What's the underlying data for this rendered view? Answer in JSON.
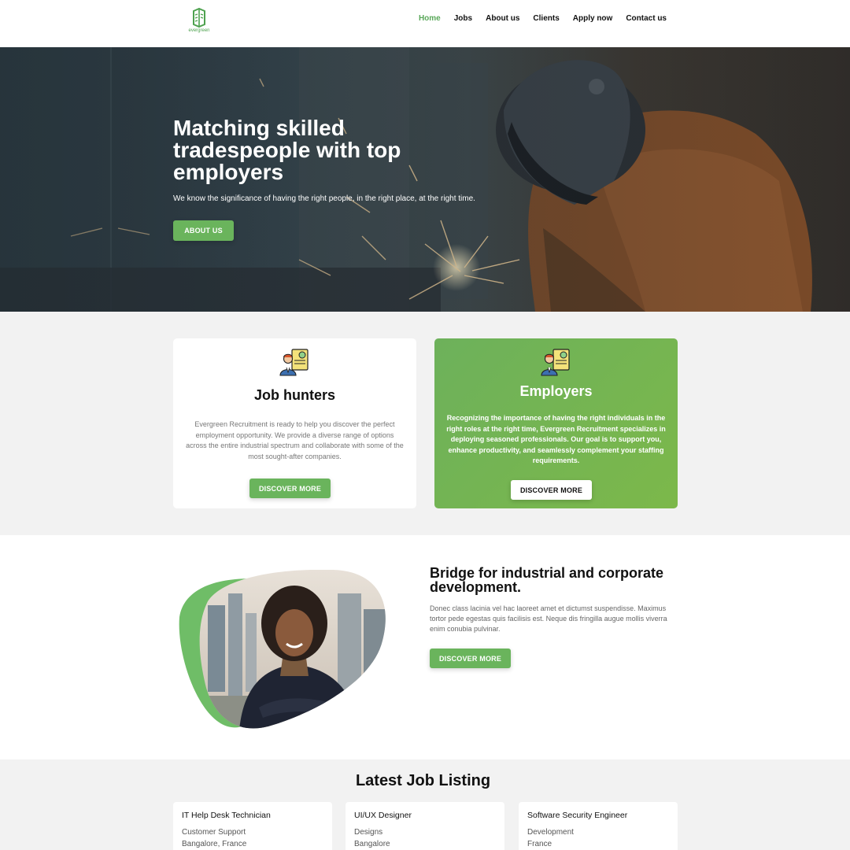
{
  "header": {
    "logo_text": "evergreen",
    "nav": [
      {
        "label": "Home",
        "active": true
      },
      {
        "label": "Jobs"
      },
      {
        "label": "About us"
      },
      {
        "label": "Clients"
      },
      {
        "label": "Apply now"
      },
      {
        "label": "Contact us"
      }
    ]
  },
  "hero": {
    "title": "Matching skilled tradespeople with top employers",
    "subtitle": "We know the significance of having the right people, in the right place, at the right time.",
    "button_label": "ABOUT US"
  },
  "cards": {
    "job_hunters": {
      "icon": "recruiter-icon",
      "title": "Job hunters",
      "text": "Evergreen Recruitment is ready to help you discover the perfect employment opportunity. We provide a diverse range of options across the entire industrial spectrum and collaborate with some of the most sought-after companies.",
      "button_label": "DISCOVER MORE"
    },
    "employers": {
      "icon": "recruiter-icon",
      "title": "Employers",
      "text": "Recognizing the importance of having the right individuals in the right roles at the right time, Evergreen Recruitment specializes in deploying seasoned professionals. Our goal is to support you, enhance productivity, and seamlessly complement your staffing requirements.",
      "button_label": "DISCOVER MORE"
    }
  },
  "bridge": {
    "title": "Bridge for industrial and corporate development.",
    "text": "Donec class lacinia vel hac laoreet amet et dictumst suspendisse. Maximus tortor pede egestas quis facilisis est. Neque dis fringilla augue mollis viverra enim conubia pulvinar.",
    "button_label": "DISCOVER MORE"
  },
  "jobs": {
    "title": "Latest Job Listing",
    "items": [
      {
        "title": "IT Help Desk Technician",
        "category": "Customer Support",
        "location": "Bangalore, France"
      },
      {
        "title": "UI/UX Designer",
        "category": "Designs",
        "location": "Bangalore"
      },
      {
        "title": "Software Security Engineer",
        "category": "Development",
        "location": "France"
      }
    ]
  },
  "colors": {
    "brand_green": "#6ab45c",
    "active_nav": "#5aa85a",
    "section_bg": "#f2f2f2"
  }
}
